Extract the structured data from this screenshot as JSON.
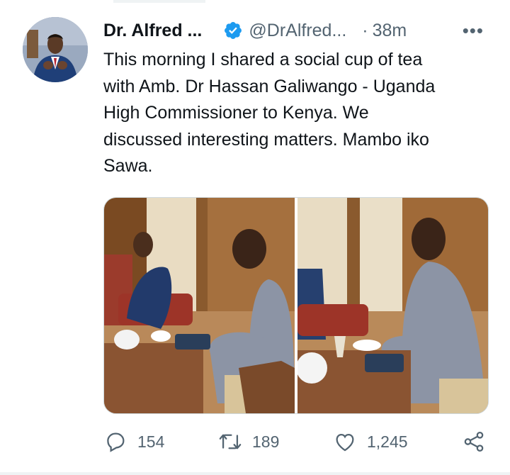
{
  "tweet": {
    "author_name": "Dr. Alfred ...",
    "author_handle": "@DrAlfred...",
    "separator": "·",
    "time": "38m",
    "more_label": "•••",
    "text": "This morning I shared a social cup of tea\nwith Amb. Dr Hassan Galiwango - Uganda\nHigh Commissioner to Kenya. We\ndiscussed interesting matters. Mambo iko\nSawa."
  },
  "actions": {
    "reply_count": "154",
    "retweet_count": "189",
    "like_count": "1,245"
  },
  "icons": {
    "avatar": "profile-photo",
    "verified": "verified-badge-icon",
    "more": "more-options-icon",
    "reply": "reply-icon",
    "retweet": "retweet-icon",
    "like": "heart-icon",
    "share": "share-icon"
  },
  "colors": {
    "text": "#0f1419",
    "secondary": "#536471",
    "verified": "#1d9bf0",
    "border": "#cfd9de"
  }
}
